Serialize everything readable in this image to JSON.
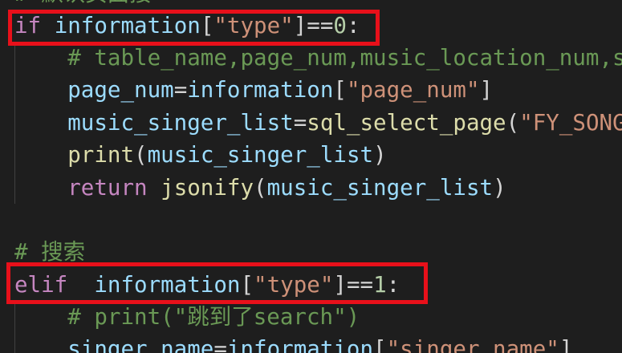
{
  "editor": {
    "theme_colors": {
      "background": "#1e1e1e",
      "keyword": "#c586c0",
      "variable": "#9cdcfe",
      "string": "#ce9178",
      "number": "#b5cea8",
      "function": "#dcdcaa",
      "comment": "#6a9955",
      "highlight_box": "#e8101a"
    },
    "lines": [
      {
        "tokens": [
          {
            "t": "cm",
            "v": "# 默认页面接"
          }
        ]
      },
      {
        "tokens": [
          {
            "t": "kw-ctrl",
            "v": "if"
          },
          {
            "t": "pl",
            "v": " "
          },
          {
            "t": "var",
            "v": "information"
          },
          {
            "t": "pl",
            "v": "["
          },
          {
            "t": "str",
            "v": "\"type\""
          },
          {
            "t": "pl",
            "v": "]=="
          },
          {
            "t": "num",
            "v": "0"
          },
          {
            "t": "pl",
            "v": ":"
          }
        ]
      },
      {
        "tokens": [
          {
            "t": "cm",
            "v": "    # table_name,page_num,music_location_num,s"
          }
        ]
      },
      {
        "tokens": [
          {
            "t": "pl",
            "v": "    "
          },
          {
            "t": "var",
            "v": "page_num"
          },
          {
            "t": "pl",
            "v": "="
          },
          {
            "t": "var",
            "v": "information"
          },
          {
            "t": "pl",
            "v": "["
          },
          {
            "t": "str",
            "v": "\"page_num\""
          },
          {
            "t": "pl",
            "v": "]"
          }
        ]
      },
      {
        "tokens": [
          {
            "t": "pl",
            "v": "    "
          },
          {
            "t": "var",
            "v": "music_singer_list"
          },
          {
            "t": "pl",
            "v": "="
          },
          {
            "t": "fn",
            "v": "sql_select_page"
          },
          {
            "t": "pl",
            "v": "("
          },
          {
            "t": "str",
            "v": "\"FY_SONG"
          }
        ]
      },
      {
        "tokens": [
          {
            "t": "pl",
            "v": "    "
          },
          {
            "t": "fn",
            "v": "print"
          },
          {
            "t": "pl",
            "v": "("
          },
          {
            "t": "var",
            "v": "music_singer_list"
          },
          {
            "t": "pl",
            "v": ")"
          }
        ]
      },
      {
        "tokens": [
          {
            "t": "pl",
            "v": "    "
          },
          {
            "t": "kw-ctrl",
            "v": "return"
          },
          {
            "t": "pl",
            "v": " "
          },
          {
            "t": "fn",
            "v": "jsonify"
          },
          {
            "t": "pl",
            "v": "("
          },
          {
            "t": "var",
            "v": "music_singer_list"
          },
          {
            "t": "pl",
            "v": ")"
          }
        ]
      },
      {
        "tokens": []
      },
      {
        "tokens": [
          {
            "t": "cm",
            "v": "# 搜索"
          }
        ]
      },
      {
        "tokens": [
          {
            "t": "kw-ctrl",
            "v": "elif"
          },
          {
            "t": "pl",
            "v": "  "
          },
          {
            "t": "var",
            "v": "information"
          },
          {
            "t": "pl",
            "v": "["
          },
          {
            "t": "str",
            "v": "\"type\""
          },
          {
            "t": "pl",
            "v": "]=="
          },
          {
            "t": "num",
            "v": "1"
          },
          {
            "t": "pl",
            "v": ":"
          }
        ]
      },
      {
        "tokens": [
          {
            "t": "cm",
            "v": "    # print(\"跳到了search\")"
          }
        ]
      },
      {
        "tokens": [
          {
            "t": "pl",
            "v": "    "
          },
          {
            "t": "var",
            "v": "singer_name"
          },
          {
            "t": "pl",
            "v": "="
          },
          {
            "t": "var",
            "v": "information"
          },
          {
            "t": "pl",
            "v": "["
          },
          {
            "t": "str",
            "v": "\"singer_name\""
          },
          {
            "t": "pl",
            "v": "]"
          }
        ]
      }
    ]
  }
}
